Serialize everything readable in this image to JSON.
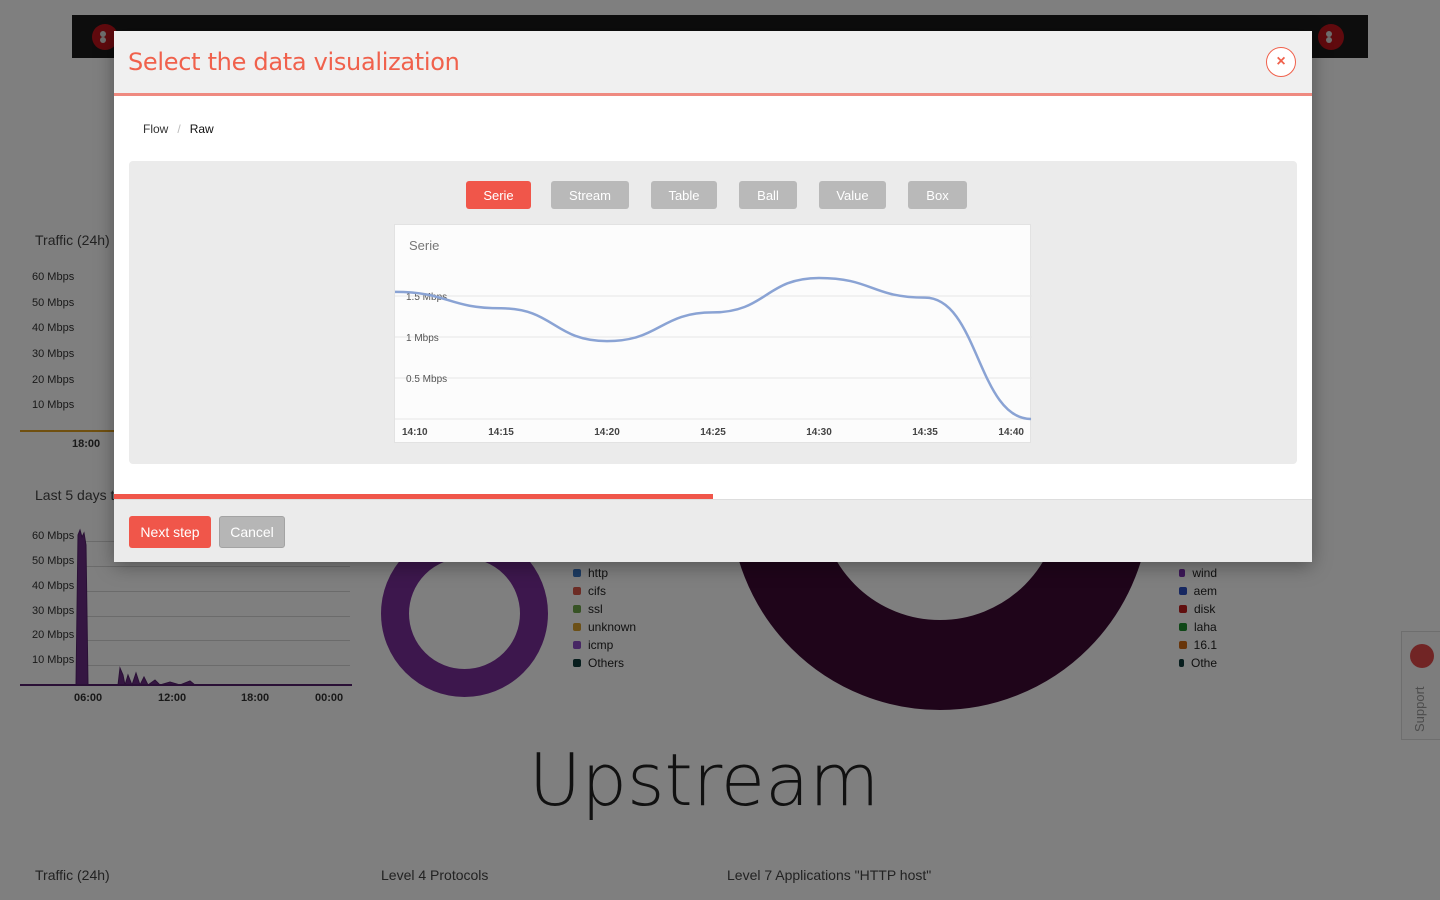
{
  "dashboard": {
    "upstream_title": "Upstream",
    "panel_traffic_title": "Traffic (24h)",
    "panel_last5_title": "Last 5 days t",
    "traffic_y_ticks": [
      "60 Mbps",
      "50 Mbps",
      "40 Mbps",
      "30 Mbps",
      "20 Mbps",
      "10 Mbps"
    ],
    "traffic_x_tick": "18:00",
    "last5_y_ticks": [
      "60 Mbps",
      "50 Mbps",
      "40 Mbps",
      "30 Mbps",
      "20 Mbps",
      "10 Mbps"
    ],
    "last5_x_ticks": [
      "06:00",
      "12:00",
      "18:00",
      "00:00"
    ],
    "protocol_legend": [
      {
        "label": "http",
        "color": "#3b76c4"
      },
      {
        "label": "cifs",
        "color": "#d9594a"
      },
      {
        "label": "ssl",
        "color": "#6fa74a"
      },
      {
        "label": "unknown",
        "color": "#d9a02e"
      },
      {
        "label": "icmp",
        "color": "#8e4fc8"
      },
      {
        "label": "Others",
        "color": "#0e3a3a"
      }
    ],
    "apps_legend": [
      {
        "label": "wind",
        "color": "#7b2fb0"
      },
      {
        "label": "aem",
        "color": "#2c4fc2"
      },
      {
        "label": "disk",
        "color": "#c21f1f"
      },
      {
        "label": "laha",
        "color": "#1f8f2f"
      },
      {
        "label": "16.1",
        "color": "#d06a14"
      },
      {
        "label": "Othe",
        "color": "#0e3a3a"
      }
    ],
    "bottom_titles": [
      "Traffic (24h)",
      "Level 4 Protocols",
      "Level 7 Applications \"HTTP host\""
    ],
    "support_label": "Support"
  },
  "modal": {
    "title": "Select the data visualization",
    "close_label": "×",
    "breadcrumb": [
      "Flow",
      "/",
      "Raw"
    ],
    "tabs": [
      "Serie",
      "Stream",
      "Table",
      "Ball",
      "Value",
      "Box"
    ],
    "active_tab": "Serie",
    "progress": 0.5,
    "next_label": "Next step",
    "cancel_label": "Cancel",
    "accent_color": "#f0564a"
  },
  "chart_data": {
    "type": "line",
    "title": "Serie",
    "x": [
      "14:10",
      "14:15",
      "14:20",
      "14:25",
      "14:30",
      "14:35",
      "14:40"
    ],
    "series": [
      {
        "values": [
          1.55,
          1.35,
          0.95,
          1.3,
          1.72,
          1.48,
          0.0
        ],
        "color": "#8aa3d4"
      }
    ],
    "y_ticks": [
      "0.5 Mbps",
      "1 Mbps",
      "1.5 Mbps"
    ],
    "ylim": [
      0,
      2.0
    ],
    "grid": true
  }
}
